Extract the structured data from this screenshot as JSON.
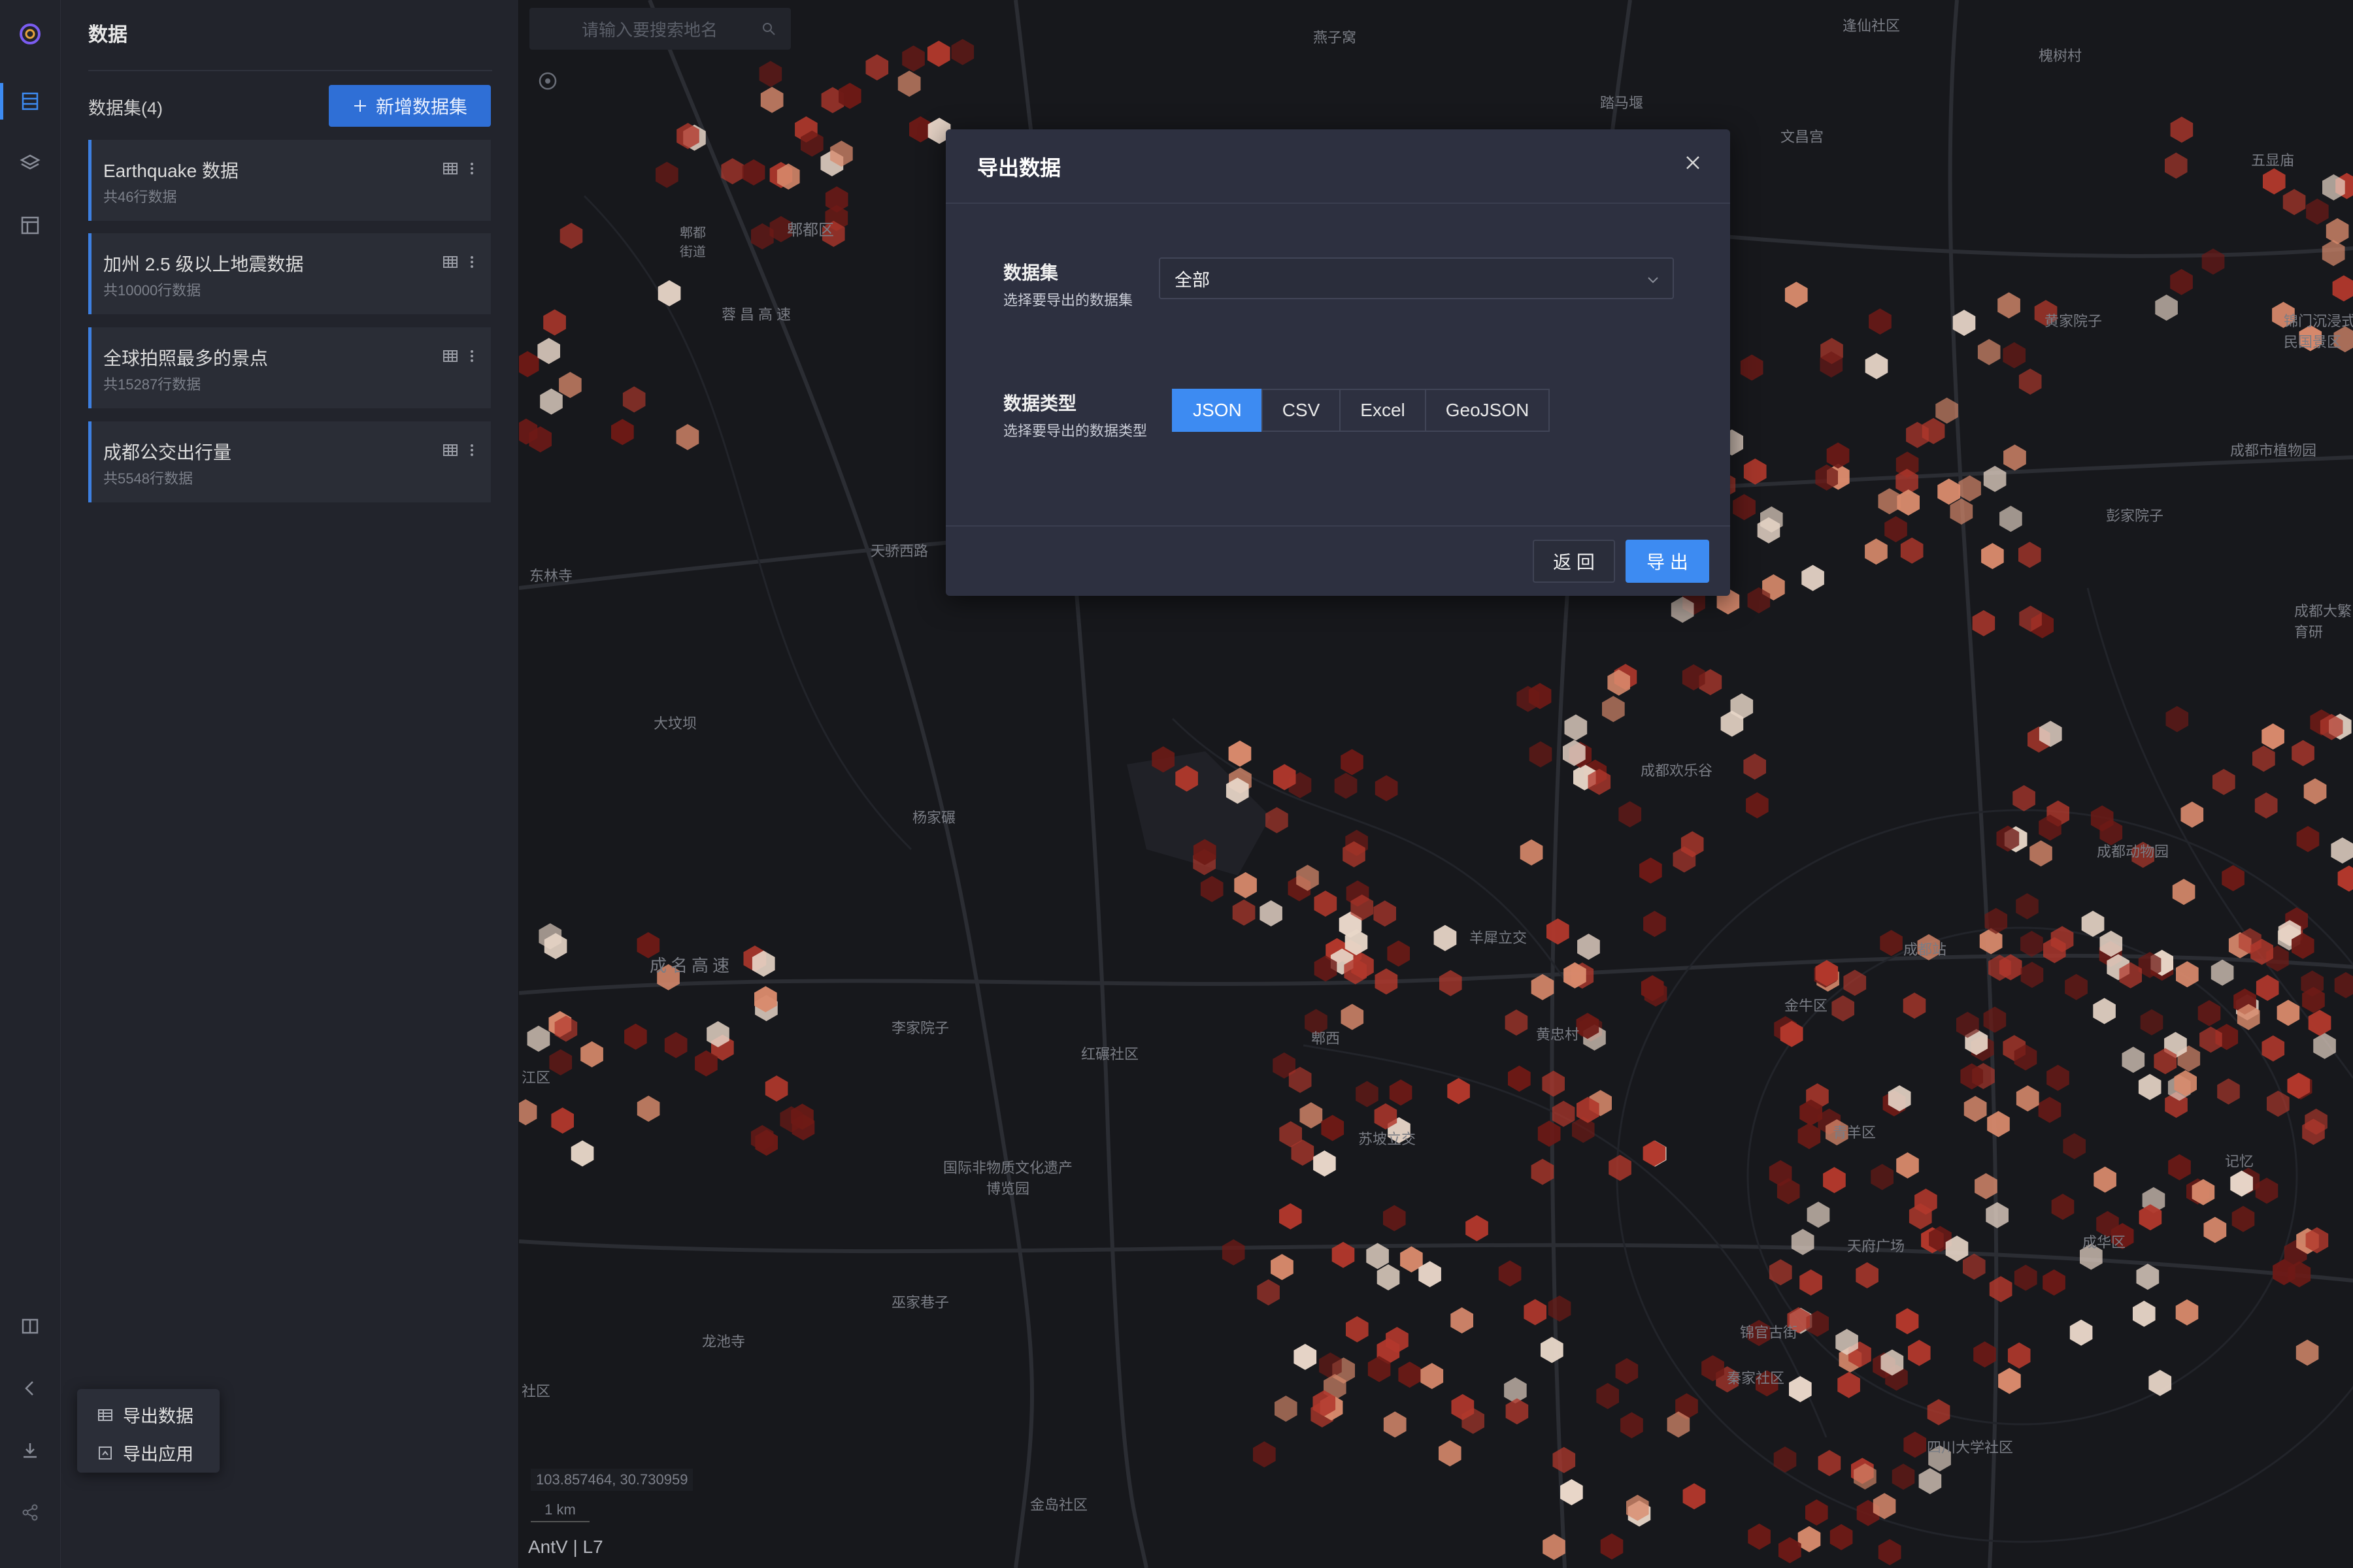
{
  "panel": {
    "title": "数据",
    "dataset_count": "数据集(4)",
    "add_button": "新增数据集",
    "datasets": [
      {
        "name": "Earthquake 数据",
        "rows": "共46行数据"
      },
      {
        "name": "加州 2.5 级以上地震数据",
        "rows": "共10000行数据"
      },
      {
        "name": "全球拍照最多的景点",
        "rows": "共15287行数据"
      },
      {
        "name": "成都公交出行量",
        "rows": "共5548行数据"
      }
    ]
  },
  "map": {
    "search_placeholder": "请输入要搜索地名",
    "coordinates": "103.857464, 30.730959",
    "scale": "1 km",
    "attribution": "AntV | L7",
    "labels": [
      "燕子窝",
      "逢仙社区",
      "槐树村",
      "五显庙",
      "文昌宫",
      "踏马堰",
      "郫都区",
      "郫都街道",
      "蓉昌高速",
      "黄家院子",
      "锦门沉浸式民国景区",
      "成都市植物园",
      "彭家院子",
      "东林寺",
      "天骄西路",
      "成都大繁育研",
      "大坟坝",
      "杨家碾",
      "成都欢乐谷",
      "成都动物园",
      "成名高速",
      "羊犀立交",
      "成都站",
      "李家院子",
      "红碾社区",
      "郫西",
      "黄忠村",
      "金牛区",
      "江区",
      "青羊区",
      "苏坡立交",
      "国际非物质文化遗产博览园",
      "成华区",
      "记忆",
      "天府广场",
      "巫家巷子",
      "龙池寺",
      "锦官古街",
      "四川大学社区",
      "金岛社区",
      "秦家社区",
      "社区"
    ]
  },
  "modal": {
    "title": "导出数据",
    "dataset_label": "数据集",
    "dataset_hint": "选择要导出的数据集",
    "dataset_value": "全部",
    "type_label": "数据类型",
    "type_hint": "选择要导出的数据类型",
    "types": [
      "JSON",
      "CSV",
      "Excel",
      "GeoJSON"
    ],
    "selected_type": "JSON",
    "back_button": "返 回",
    "export_button": "导 出"
  },
  "export_menu": {
    "items": [
      {
        "label": "导出数据",
        "icon": "table-icon"
      },
      {
        "label": "导出应用",
        "icon": "app-icon"
      }
    ]
  },
  "colors": {
    "accent": "#3d8bf2",
    "hex_dark": "#6e1a16",
    "hex_mid": "#b2382c",
    "hex_light": "#d98a6c",
    "hex_pale": "#e8d6c8"
  }
}
